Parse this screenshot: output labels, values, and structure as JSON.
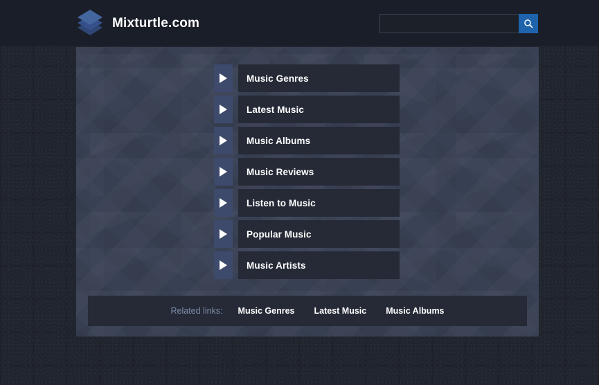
{
  "header": {
    "brand_name": "Mixturtle.com",
    "logo_icon": "stacked-layers-icon",
    "search": {
      "value": "",
      "placeholder": "",
      "button_icon": "search-icon"
    }
  },
  "main": {
    "menu_items": [
      {
        "label": "Music Genres",
        "icon": "play-arrow-icon"
      },
      {
        "label": "Latest Music",
        "icon": "play-arrow-icon"
      },
      {
        "label": "Music Albums",
        "icon": "play-arrow-icon"
      },
      {
        "label": "Music Reviews",
        "icon": "play-arrow-icon"
      },
      {
        "label": "Listen to Music",
        "icon": "play-arrow-icon"
      },
      {
        "label": "Popular Music",
        "icon": "play-arrow-icon"
      },
      {
        "label": "Music Artists",
        "icon": "play-arrow-icon"
      }
    ]
  },
  "footer": {
    "related_label": "Related links:",
    "related_links": [
      {
        "label": "Music Genres"
      },
      {
        "label": "Latest Music"
      },
      {
        "label": "Music Albums"
      }
    ]
  },
  "colors": {
    "page_background": "#20242e",
    "header_background": "#1a1e28",
    "panel_background": "#3a4256",
    "row_background": "#252a36",
    "arrow_background": "#3d4a6b",
    "accent_blue": "#1f63ad",
    "logo_blue": "#44669f",
    "muted_text": "#7e8da8",
    "text": "#ffffff"
  }
}
